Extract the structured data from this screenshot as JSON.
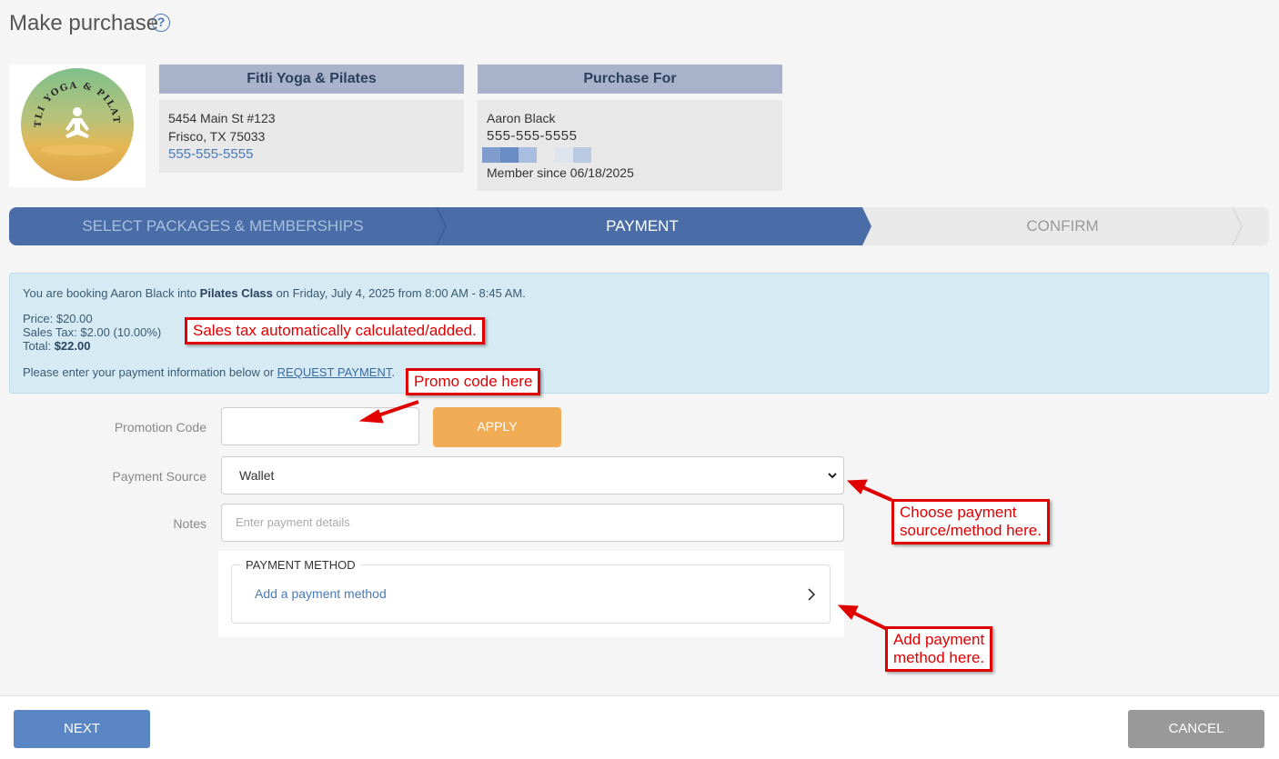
{
  "page": {
    "title": "Make purchase",
    "help_icon": "question-circle-icon"
  },
  "studio": {
    "name": "Fitli Yoga & Pilates",
    "address1": "5454 Main St #123",
    "address2": "Frisco, TX 75033",
    "phone": "555-555-5555",
    "logo_text": "FITLI YOGA & PILATES"
  },
  "purchase_for": {
    "heading": "Purchase For",
    "name": "Aaron Black",
    "phone": "555-555-5555",
    "member_since": "Member since 06/18/2025"
  },
  "steps": [
    {
      "label": "SELECT PACKAGES & MEMBERSHIPS",
      "state": "complete"
    },
    {
      "label": "PAYMENT",
      "state": "active"
    },
    {
      "label": "CONFIRM",
      "state": "pending"
    }
  ],
  "booking": {
    "prefix": "You are booking Aaron Black into ",
    "class_name": "Pilates Class",
    "suffix": " on Friday, July 4, 2025 from 8:00 AM - 8:45 AM.",
    "price": "Price: $20.00",
    "sales_tax": "Sales Tax: $2.00 (10.00%)",
    "total_label": "Total: ",
    "total_value": "$22.00",
    "enter_info": "Please enter your payment information below or ",
    "request_link": "REQUEST PAYMENT",
    "period": "."
  },
  "form": {
    "promo_label": "Promotion Code",
    "promo_value": "",
    "apply_label": "APPLY",
    "source_label": "Payment Source",
    "source_value": "Wallet",
    "notes_label": "Notes",
    "notes_placeholder": "Enter payment details",
    "payment_method_legend": "PAYMENT METHOD",
    "add_payment_method": "Add a payment method"
  },
  "annotations": {
    "sales_tax": "Sales tax automatically calculated/added.",
    "promo": "Promo code here",
    "choose_source_1": "Choose payment",
    "choose_source_2": "source/method here.",
    "add_method_1": "Add payment",
    "add_method_2": "method here."
  },
  "footer": {
    "next_label": "NEXT",
    "cancel_label": "CANCEL"
  },
  "colors": {
    "accent": "#4a6da7",
    "apply": "#f0ad55",
    "next": "#5b86c5",
    "cancel": "#999999",
    "annotation": "#e00000"
  }
}
